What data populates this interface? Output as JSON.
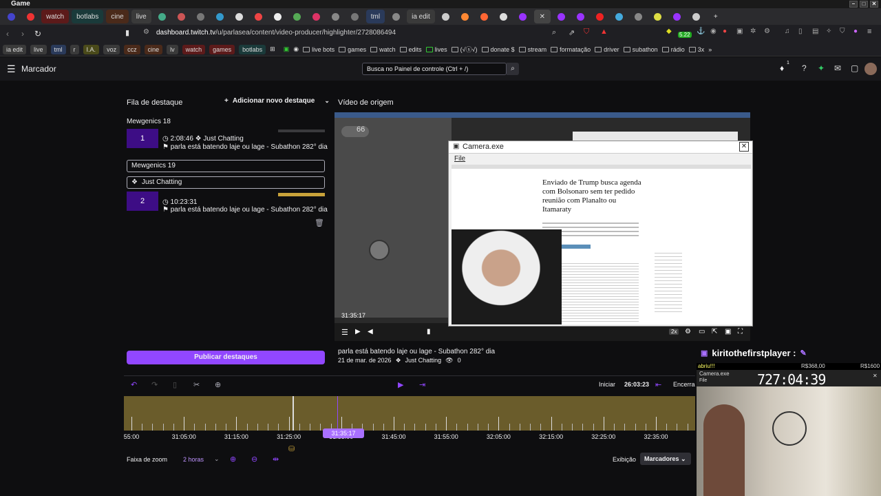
{
  "os": {
    "title": "Game"
  },
  "tabs": [
    {
      "label": "watch",
      "color": "#5c1a1a"
    },
    {
      "label": "botlabs",
      "color": "#1a3a3a"
    },
    {
      "label": "cine",
      "color": "#4a2a1a"
    },
    {
      "label": "live",
      "color": "#3a3a3a"
    },
    {
      "label": "tml",
      "color": "#2a3a5a"
    },
    {
      "label": "ia edit",
      "color": "#3a3a3a"
    }
  ],
  "browser": {
    "url_host": "dashboard.twitch.tv",
    "url_path": "/u/parlasea/content/video-producer/highlighter/2728086494",
    "ext_badge": "5.22"
  },
  "bookmarks": {
    "pills": [
      "ia edit",
      "live",
      "tml",
      "r",
      "I.A.",
      "voz",
      "ccz",
      "cine",
      "lv",
      "watch",
      "games",
      "botlabs"
    ],
    "folders": [
      "live bots",
      "games",
      "watch",
      "edits",
      "lives",
      "(√ⓢ√)",
      "donate $",
      "stream",
      "formatação",
      "driver",
      "subathon",
      "rádio",
      "3x"
    ]
  },
  "twitch": {
    "page_title": "Marcador",
    "search_placeholder": "Busca no Painel de controle (Ctrl + /)",
    "notif_count": "1"
  },
  "queue": {
    "title": "Fila de destaque",
    "add_label": "Adicionar novo destaque",
    "group1": "Mewgenics 18",
    "clip1": {
      "num": "1",
      "time": "2:08:46",
      "category": "Just Chatting",
      "title": "parla está batendo laje ou lage - Subathon 282° dia"
    },
    "group2_field": "Mewgenics 19",
    "category_field": "Just Chatting",
    "clip2": {
      "num": "2",
      "time": "10:23:31",
      "title": "parla está batendo laje ou lage - Subathon 282° dia"
    },
    "publish_label": "Publicar destaques"
  },
  "source": {
    "title": "Vídeo de origem",
    "timestamp": "31:35:17",
    "badge_num": "66",
    "speed": "2x",
    "video_title": "parla está batendo laje ou lage - Subathon 282° dia",
    "date": "21 de mar. de 2026",
    "category": "Just Chatting",
    "views": "0"
  },
  "camera": {
    "title": "Camera.exe",
    "menu_file": "File",
    "headline": "Enviado de Trump busca agenda com Bolsonaro sem ter pedido reunião com Planalto ou Itamaraty"
  },
  "timeline": {
    "start_label": "Iniciar",
    "start_time": "26:03:23",
    "end_label": "Encerra",
    "playhead": "31:35:17",
    "ticks": [
      "55:00",
      "31:05:00",
      "31:15:00",
      "31:25:00",
      "31:35:00",
      "31:45:00",
      "31:55:00",
      "32:05:00",
      "32:15:00",
      "32:25:00",
      "32:35:00"
    ]
  },
  "zoom": {
    "label": "Faixa de zoom",
    "value": "2 horas",
    "exhibit_label": "Exibição",
    "markers_label": "Marcadores"
  },
  "overlay": {
    "chat_user": "kiritothefirstplayer :",
    "chat_msg": "abriu!!!",
    "donation1": "R$368,00",
    "donation2": "R$1600",
    "cam_title": "Camera.exe",
    "cam_file": "File",
    "timer": "727:04:39"
  },
  "colors": {
    "accent": "#9147ff",
    "accent_dark": "#3d0d85",
    "bg": "#0e0e10",
    "timeline": "#6a5c2b"
  }
}
